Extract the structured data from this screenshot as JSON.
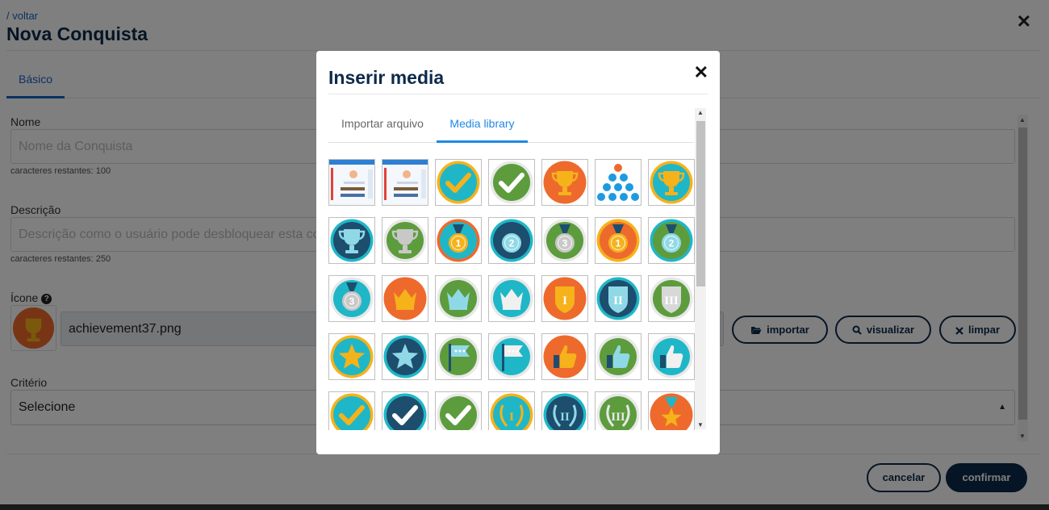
{
  "header": {
    "back_link": "/ voltar",
    "title": "Nova Conquista"
  },
  "tabs": [
    {
      "label": "Básico"
    }
  ],
  "form": {
    "name_label": "Nome",
    "name_placeholder": "Nome da Conquista",
    "name_hint": "caracteres restantes: 100",
    "desc_label": "Descrição",
    "desc_placeholder": "Descrição como o usuário pode desbloquear esta conquista",
    "desc_hint": "caracteres restantes: 250",
    "icon_label": "Ícone",
    "icon_file": "achievement37.png",
    "criteria_label": "Critério",
    "criteria_value": "Selecione"
  },
  "icon_buttons": {
    "import_label": "importar",
    "view_label": "visualizar",
    "clear_label": "limpar"
  },
  "footer": {
    "cancel_label": "cancelar",
    "confirm_label": "confirmar"
  },
  "modal": {
    "title": "Inserir media",
    "tabs": [
      "Importar arquivo",
      "Media library"
    ],
    "active_tab": "Media library",
    "media_items": [
      {
        "kind": "screenshot"
      },
      {
        "kind": "screenshot"
      },
      {
        "kind": "check",
        "bg": "#1fb7c7",
        "ring": "#f5b21b",
        "fg": "#f5b21b"
      },
      {
        "kind": "check",
        "bg": "#5d9c3d",
        "ring": "#e8e8e8",
        "fg": "#ffffff"
      },
      {
        "kind": "trophy",
        "bg": "#ee6a2c",
        "ring": "#ee6a2c",
        "fg": "#f5b21b"
      },
      {
        "kind": "dots"
      },
      {
        "kind": "trophy",
        "bg": "#1fb7c7",
        "ring": "#f5b21b",
        "fg": "#f5b21b"
      },
      {
        "kind": "trophy",
        "bg": "#1d4e6e",
        "ring": "#1fb7c7",
        "fg": "#8fd9e6"
      },
      {
        "kind": "trophy",
        "bg": "#5d9c3d",
        "ring": "#e8e8e8",
        "fg": "#c8c8c8"
      },
      {
        "kind": "medal",
        "bg": "#1fb7c7",
        "ring": "#ee6a2c",
        "fg": "#f5b21b",
        "label": "1"
      },
      {
        "kind": "medal",
        "bg": "#1d4e6e",
        "ring": "#1fb7c7",
        "fg": "#8fd9e6",
        "label": "2"
      },
      {
        "kind": "medal",
        "bg": "#5d9c3d",
        "ring": "#e8e8e8",
        "fg": "#c8c8c8",
        "label": "3"
      },
      {
        "kind": "medal",
        "bg": "#ee6a2c",
        "ring": "#f5b21b",
        "fg": "#f5b21b",
        "label": "1"
      },
      {
        "kind": "medal",
        "bg": "#5d9c3d",
        "ring": "#1fb7c7",
        "fg": "#8fd9e6",
        "label": "2"
      },
      {
        "kind": "medal",
        "bg": "#1fb7c7",
        "ring": "#e8e8e8",
        "fg": "#c8c8c8",
        "label": "3"
      },
      {
        "kind": "crown",
        "bg": "#ee6a2c",
        "ring": "#ee6a2c",
        "fg": "#f5b21b"
      },
      {
        "kind": "crown",
        "bg": "#5d9c3d",
        "ring": "#e8e8e8",
        "fg": "#8fd9e6"
      },
      {
        "kind": "crown",
        "bg": "#1fb7c7",
        "ring": "#e8e8e8",
        "fg": "#f0f0f0"
      },
      {
        "kind": "shield",
        "bg": "#ee6a2c",
        "ring": "#ee6a2c",
        "fg": "#f5b21b",
        "label": "I"
      },
      {
        "kind": "shield",
        "bg": "#1d4e6e",
        "ring": "#1fb7c7",
        "fg": "#8fd9e6",
        "label": "II"
      },
      {
        "kind": "shield",
        "bg": "#5d9c3d",
        "ring": "#e8e8e8",
        "fg": "#d8d8d8",
        "label": "III"
      },
      {
        "kind": "star",
        "bg": "#1fb7c7",
        "ring": "#f5b21b",
        "fg": "#f5b21b"
      },
      {
        "kind": "star",
        "bg": "#1d4e6e",
        "ring": "#1fb7c7",
        "fg": "#8fd9e6"
      },
      {
        "kind": "flag",
        "bg": "#5d9c3d",
        "ring": "#e8e8e8",
        "fg": "#8fd9e6"
      },
      {
        "kind": "flag",
        "bg": "#1fb7c7",
        "ring": "#e8e8e8",
        "fg": "#f0f0f0"
      },
      {
        "kind": "thumb",
        "bg": "#ee6a2c",
        "ring": "#ee6a2c",
        "fg": "#f5b21b"
      },
      {
        "kind": "thumb",
        "bg": "#5d9c3d",
        "ring": "#e8e8e8",
        "fg": "#8fd9e6"
      },
      {
        "kind": "thumb",
        "bg": "#1fb7c7",
        "ring": "#e8e8e8",
        "fg": "#f0f0f0"
      },
      {
        "kind": "check",
        "bg": "#1fb7c7",
        "ring": "#f5b21b",
        "fg": "#f5b21b"
      },
      {
        "kind": "check",
        "bg": "#1d4e6e",
        "ring": "#1fb7c7",
        "fg": "#ffffff"
      },
      {
        "kind": "check",
        "bg": "#5d9c3d",
        "ring": "#e8e8e8",
        "fg": "#ffffff"
      },
      {
        "kind": "laurel",
        "bg": "#1fb7c7",
        "ring": "#f5b21b",
        "fg": "#f5b21b",
        "label": "I"
      },
      {
        "kind": "laurel",
        "bg": "#1d4e6e",
        "ring": "#1fb7c7",
        "fg": "#8fd9e6",
        "label": "II"
      },
      {
        "kind": "laurel",
        "bg": "#5d9c3d",
        "ring": "#e8e8e8",
        "fg": "#e8e8e8",
        "label": "III"
      },
      {
        "kind": "medal-star",
        "bg": "#ee6a2c",
        "ring": "#ee6a2c",
        "fg": "#f5b21b"
      }
    ]
  }
}
